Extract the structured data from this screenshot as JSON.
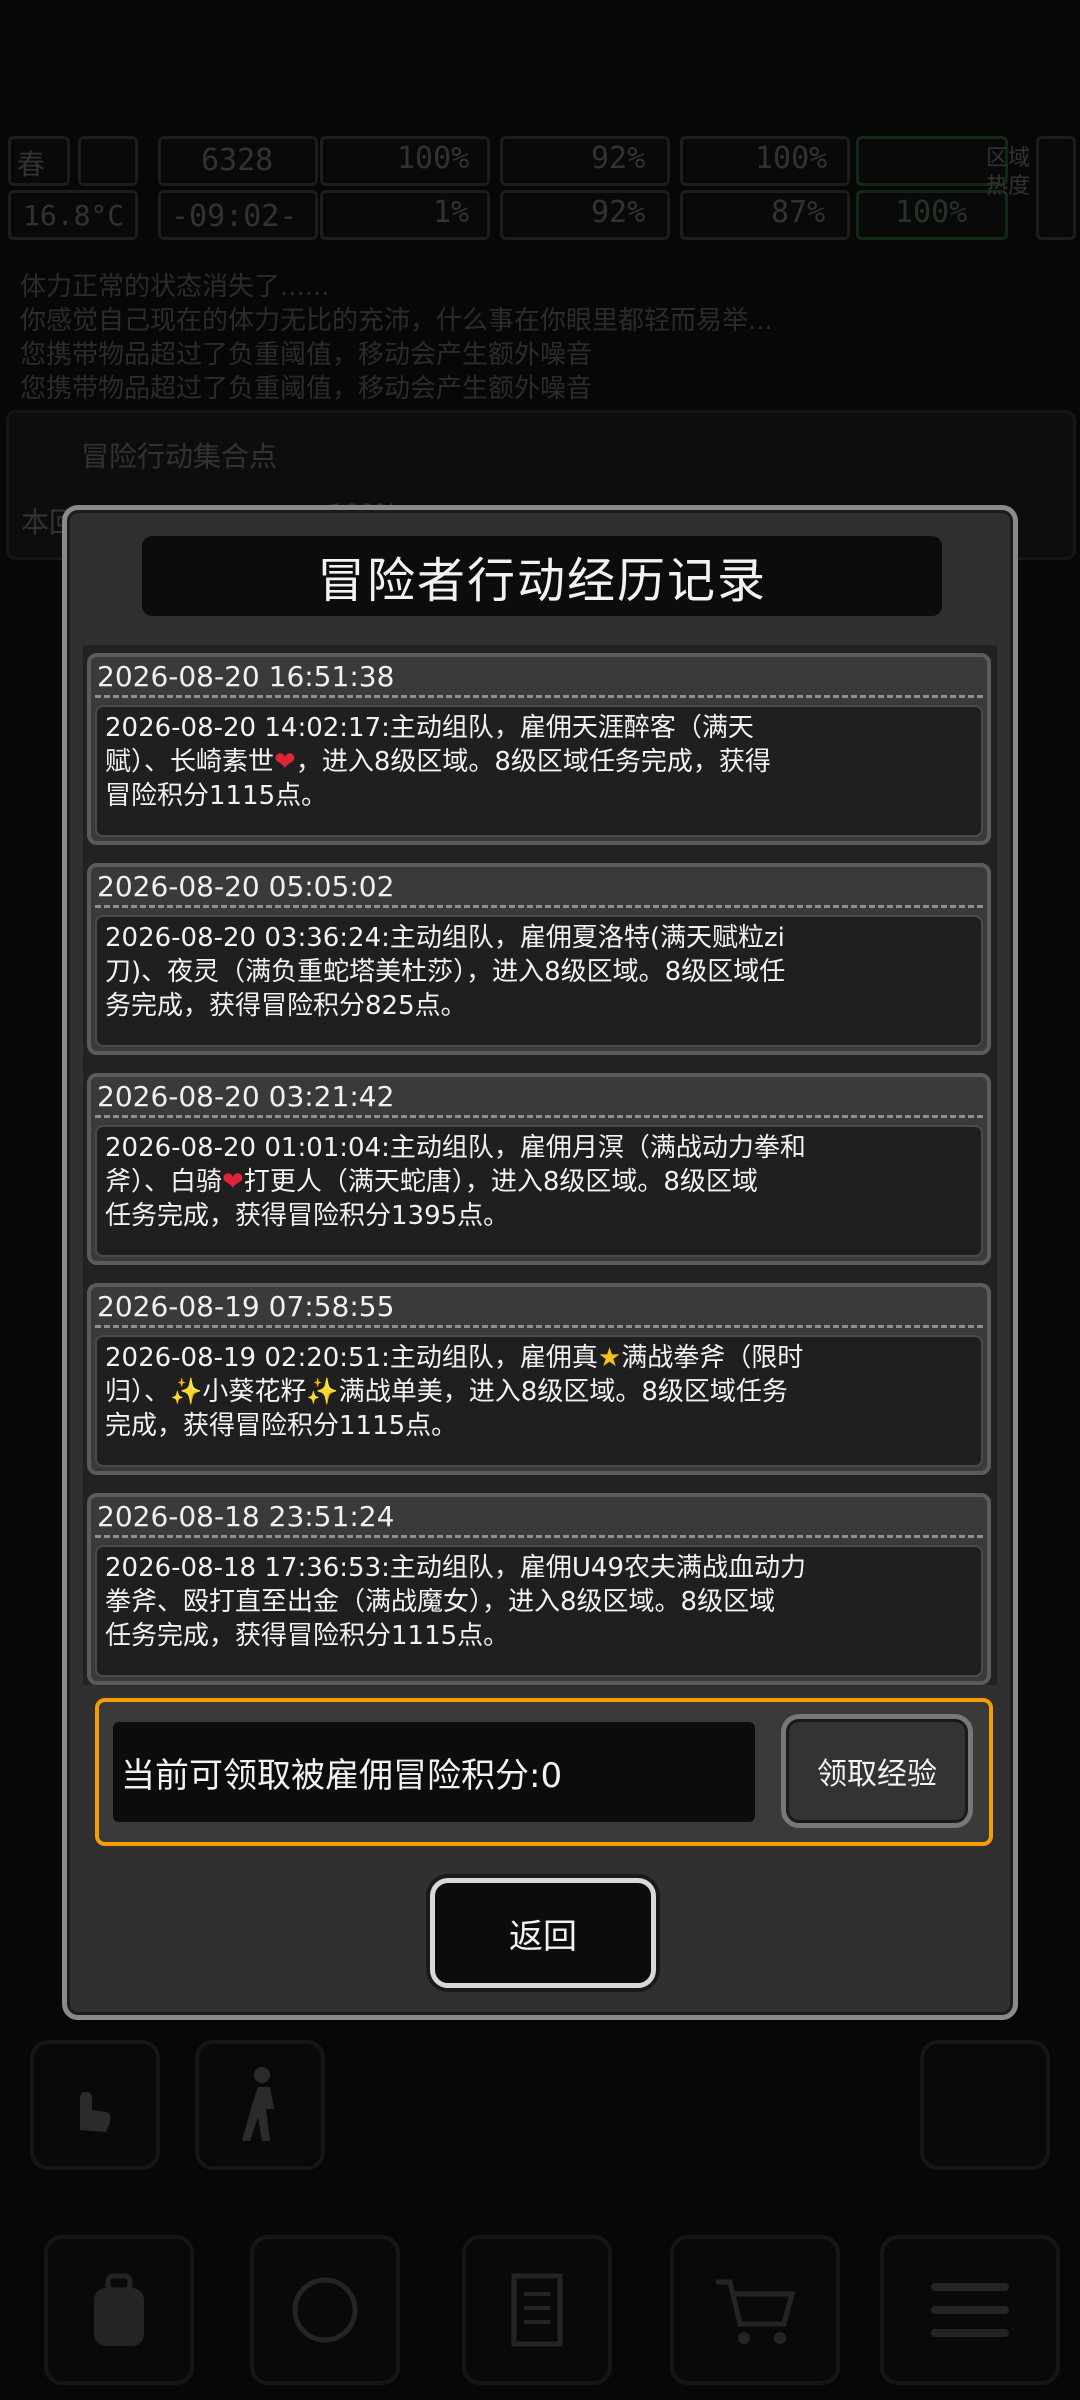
{
  "status": {
    "season": "春",
    "temperature": "16.8°C",
    "clock_top": "6328",
    "clock_bottom": "-09:02-",
    "stats": [
      "100%",
      "92%",
      "100%",
      "1%",
      "92%",
      "87%",
      "100%"
    ],
    "zone_label_1": "区域",
    "zone_label_2": "热度"
  },
  "background_log": [
    "体力正常的状态消失了......",
    "你感觉自己现在的体力无比的充沛，什么事在你眼里都轻而易举...",
    "您携带物品超过了负重阈值，移动会产生额外噪音",
    "您携带物品超过了负重阈值，移动会产生额外噪音"
  ],
  "background_panel": {
    "title": "冒险行动集合点",
    "sub": "本回",
    "percent": "100%"
  },
  "modal": {
    "title": "冒险者行动经历记录",
    "entries": [
      {
        "time": "2026-08-20 16:51:38",
        "parts": [
          "2026-08-20 14:02:17:主动组队，雇佣天涯醉客（满天\n赋）、长崎素世",
          "❤",
          "，进入8级区域。8级区域任务完成，获得\n冒险积分1115点。"
        ]
      },
      {
        "time": "2026-08-20 05:05:02",
        "parts": [
          "2026-08-20 03:36:24:主动组队，雇佣夏洛特(满天赋粒zi\n刀)、夜灵（满负重蛇塔美杜莎），进入8级区域。8级区域任\n务完成，获得冒险积分825点。"
        ]
      },
      {
        "time": "2026-08-20 03:21:42",
        "parts": [
          "2026-08-20 01:01:04:主动组队，雇佣月溟（满战动力拳和\n斧）、白骑",
          "❤",
          "打更人（满天蛇唐），进入8级区域。8级区域\n任务完成，获得冒险积分1395点。"
        ]
      },
      {
        "time": "2026-08-19 07:58:55",
        "parts": [
          "2026-08-19 02:20:51:主动组队，雇佣真",
          "★",
          "满战拳斧（限时\n归）、",
          "✨",
          "小葵花籽",
          "✨",
          "满战单美，进入8级区域。8级区域任务\n完成，获得冒险积分1115点。"
        ]
      },
      {
        "time": "2026-08-18 23:51:24",
        "parts": [
          "2026-08-18 17:36:53:主动组队，雇佣U49农夫满战血动力\n拳斧、殴打直至出金（满战魔女），进入8级区域。8级区域\n任务完成，获得冒险积分1115点。"
        ]
      }
    ],
    "claim_label": "当前可领取被雇佣冒险积分:0",
    "claim_button": "领取经验",
    "back_button": "返回"
  },
  "colors": {
    "accent_border": "#f29f05",
    "heart": "#e0243a",
    "star": "#f6c21b",
    "health_green": "#3fb34f"
  },
  "icons": [
    "season-spring-icon",
    "weather-cloud-icon",
    "medkit-icon",
    "stomach-icon",
    "water-drop-icon",
    "heart-icon",
    "armor-icon",
    "boot-icon",
    "speaker-icon",
    "hand-pointer-icon",
    "walk-icon",
    "hunter-icon",
    "backpack-icon",
    "brain-icon",
    "notebook-icon",
    "cart-icon",
    "menu-list-icon"
  ]
}
